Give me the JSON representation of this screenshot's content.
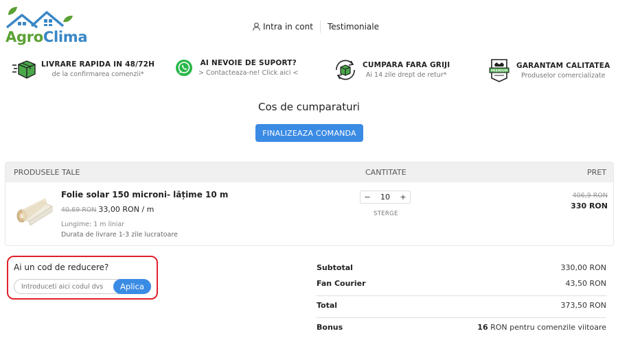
{
  "brand": {
    "name_part1": "Agro",
    "name_part2": "Clima"
  },
  "nav": {
    "login": "Intra in cont",
    "testimonials": "Testimoniale"
  },
  "features": [
    {
      "icon": "delivery-box-icon",
      "title": "LIVRARE RAPIDA IN 48/72H",
      "subtitle": "de la confirmarea comenzii*"
    },
    {
      "icon": "whatsapp-icon",
      "title": "AI NEVOIE DE SUPORT?",
      "subtitle": "> Contacteaza-ne! Click aici <"
    },
    {
      "icon": "return-box-icon",
      "title": "CUMPARA FARA GRIJI",
      "subtitle": "Ai 14 zile drept de retur*"
    },
    {
      "icon": "premium-badge-icon",
      "title": "GARANTAM CALITATEA",
      "subtitle": "Produselor comercializate"
    }
  ],
  "cart": {
    "title": "Cos de cumparaturi",
    "checkout_label": "FINALIZEAZA COMANDA",
    "headers": {
      "product": "PRODUSELE TALE",
      "quantity": "CANTITATE",
      "price": "PRET"
    },
    "items": [
      {
        "name": "Folie solar 150 microni- lățime 10 m",
        "old_unit_price": "40,69 RON",
        "unit_price": "33,00 RON / m",
        "length": "Lungime: 1 m liniar",
        "delivery": "Durata de livrare 1-3 zile lucratoare",
        "quantity": "10",
        "remove_label": "STERGE",
        "old_total": "406,9 RON",
        "total": "330 RON"
      }
    ]
  },
  "discount": {
    "label": "Ai un cod de reducere?",
    "placeholder": "Introduceti aici codul dvs",
    "apply_label": "Aplica"
  },
  "summary": {
    "subtotal_label": "Subtotal",
    "subtotal_value": "330,00 RON",
    "shipping_label": "Fan Courier",
    "shipping_value": "43,50 RON",
    "total_label": "Total",
    "total_value": "373,50 RON",
    "bonus_label": "Bonus",
    "bonus_amount": "16",
    "bonus_text": "RON pentru comenzile viitoare"
  },
  "colors": {
    "accent": "#3a8be4",
    "brand_green": "#5aa134",
    "brand_blue": "#3a87c6",
    "highlight": "#e0202a"
  }
}
